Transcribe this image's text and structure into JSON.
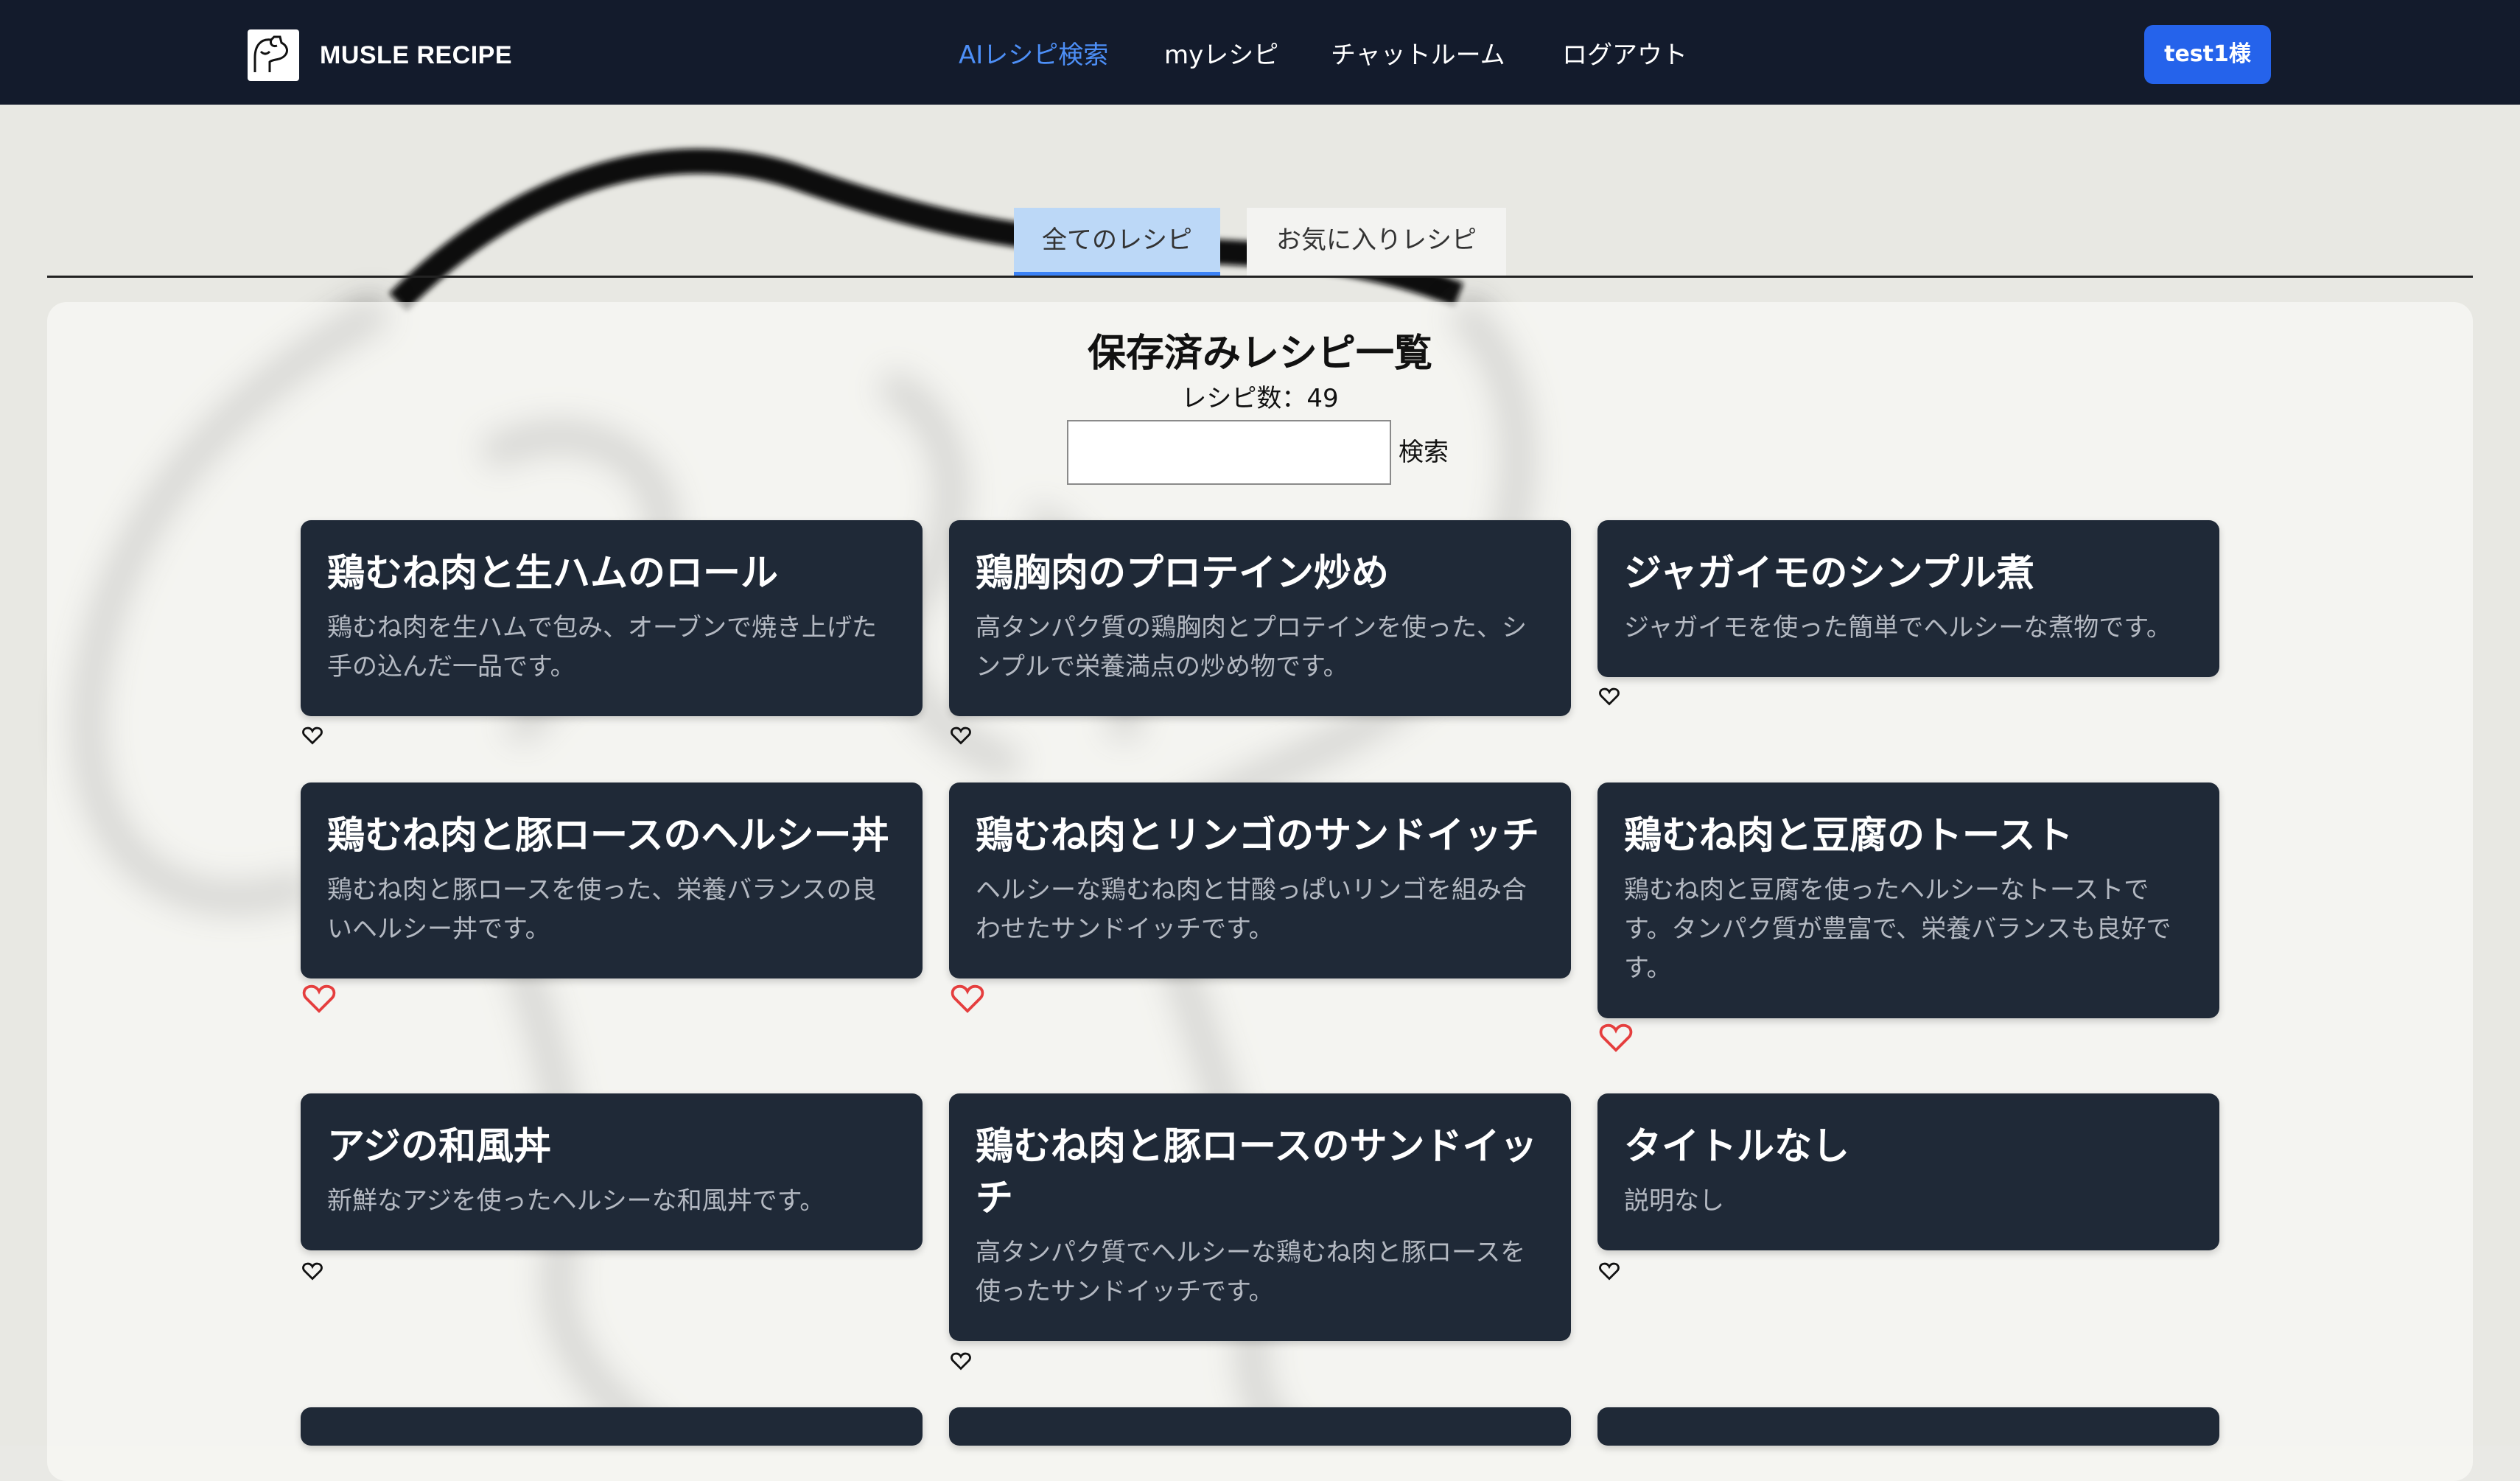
{
  "navbar": {
    "brand": "MUSLE RECIPE",
    "links": [
      {
        "label": "AIレシピ検索",
        "active": true
      },
      {
        "label": "myレシピ",
        "active": false
      },
      {
        "label": "チャットルーム",
        "active": false
      },
      {
        "label": "ログアウト",
        "active": false
      }
    ],
    "user_button": "test1様"
  },
  "tabs": [
    {
      "label": "全てのレシピ",
      "active": true
    },
    {
      "label": "お気に入りレシピ",
      "active": false
    }
  ],
  "main": {
    "title": "保存済みレシピ一覧",
    "count_text": "レシピ数：49",
    "search": {
      "value": "",
      "button": "検索"
    }
  },
  "recipes": [
    {
      "title": "鶏むね肉と生ハムのロール",
      "description": "鶏むね肉を生ハムで包み、オーブンで焼き上げた手の込んだ一品です。",
      "favorite": false
    },
    {
      "title": "鶏胸肉のプロテイン炒め",
      "description": "高タンパク質の鶏胸肉とプロテインを使った、シンプルで栄養満点の炒め物です。",
      "favorite": false
    },
    {
      "title": "ジャガイモのシンプル煮",
      "description": "ジャガイモを使った簡単でヘルシーな煮物です。",
      "favorite": false
    },
    {
      "title": "鶏むね肉と豚ロースのヘルシー丼",
      "description": "鶏むね肉と豚ロースを使った、栄養バランスの良いヘルシー丼です。",
      "favorite": true
    },
    {
      "title": "鶏むね肉とリンゴのサンドイッチ",
      "description": "ヘルシーな鶏むね肉と甘酸っぱいリンゴを組み合わせたサンドイッチです。",
      "favorite": true
    },
    {
      "title": "鶏むね肉と豆腐のトースト",
      "description": "鶏むね肉と豆腐を使ったヘルシーなトーストです。タンパク質が豊富で、栄養バランスも良好です。",
      "favorite": true
    },
    {
      "title": "アジの和風丼",
      "description": "新鮮なアジを使ったヘルシーな和風丼です。",
      "favorite": false
    },
    {
      "title": "鶏むね肉と豚ロースのサンドイッチ",
      "description": "高タンパク質でヘルシーな鶏むね肉と豚ロースを使ったサンドイッチです。",
      "favorite": false
    },
    {
      "title": "タイトルなし",
      "description": "説明なし",
      "favorite": false
    }
  ],
  "colors": {
    "navbar": "#131b2c",
    "accent": "#2563eb",
    "active_link": "#4d8ff7",
    "card": "#1f2937",
    "heart_favorite": "#e53e3e"
  },
  "icons": {
    "logo": "flexing-arm-icon",
    "favorite": "heart-icon"
  }
}
